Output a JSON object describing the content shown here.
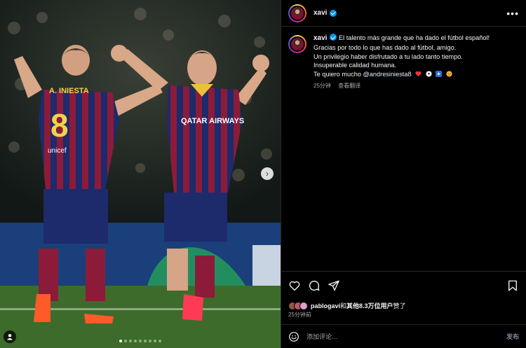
{
  "post": {
    "author": "xavi",
    "verified": true,
    "caption_lines": [
      "El talento más grande que ha dado el fútbol español!",
      "Gracias por todo lo que has dado al fútbol, amigo.",
      "Un privilegio haber disfrutado a tu lado tanto tiempo.",
      "Insuperable calidad humana."
    ],
    "last_line_prefix": "Te quiero mucho ",
    "mention": "@andresiniesta8",
    "caption_emojis": [
      "heart",
      "soccer-ball",
      "sparkles",
      "smiling-face"
    ],
    "caption_time": "25分钟",
    "translate_label": "查看翻译"
  },
  "likes": {
    "first_user": "pablogavi",
    "joiner": "和",
    "others": "其他8.3万位用户",
    "suffix": "赞了"
  },
  "timestamp": "25分钟前",
  "composer": {
    "placeholder": "添加评论…",
    "post_label": "发布"
  },
  "media": {
    "carousel_count": 9,
    "active_index": 0,
    "jersey_left_name": "A. INIESTA",
    "jersey_left_number": "8",
    "jersey_left_sponsor": "unicef",
    "jersey_right_sponsor": "QATAR AIRWAYS"
  },
  "colors": {
    "accent_blue": "#0095f6",
    "heart_red": "#ff3040",
    "border": "#262626",
    "secondary_text": "#a8a8a8"
  }
}
